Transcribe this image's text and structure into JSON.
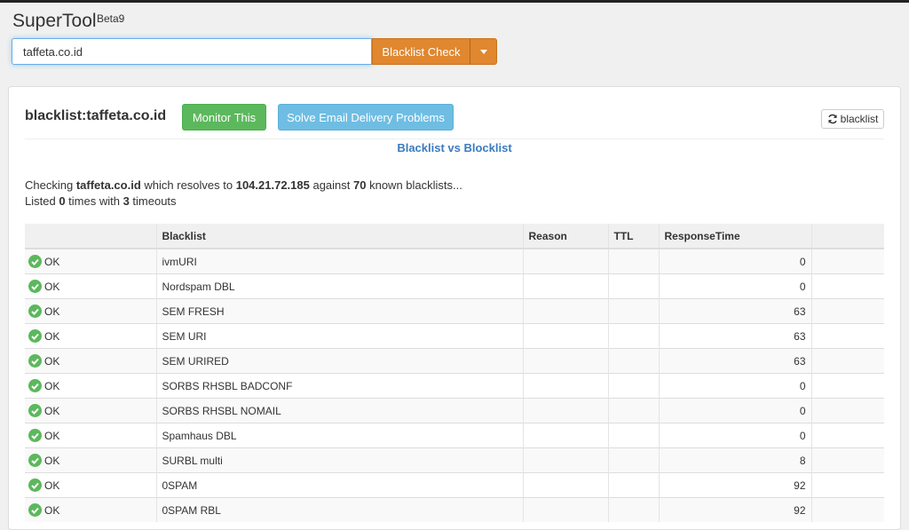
{
  "app": {
    "title": "SuperTool",
    "beta": "Beta9"
  },
  "search": {
    "value": "taffeta.co.id",
    "button_label": "Blacklist Check"
  },
  "panel": {
    "heading": "blacklist:taffeta.co.id",
    "monitor_label": "Monitor This",
    "solve_label": "Solve Email Delivery Problems",
    "refresh_label": "blacklist",
    "link_vs": "Blacklist vs Blocklist"
  },
  "summary": {
    "checking_prefix": "Checking ",
    "domain": "taffeta.co.id",
    "resolves_text": " which resolves to ",
    "ip": "104.21.72.185",
    "against_text": " against ",
    "count": "70",
    "known_text": " known blacklists...",
    "listed_prefix": "Listed ",
    "listed_count": "0",
    "times_text": " times with ",
    "timeouts_count": "3",
    "timeouts_text": " timeouts"
  },
  "table": {
    "columns": [
      "",
      "Blacklist",
      "Reason",
      "TTL",
      "ResponseTime",
      ""
    ],
    "rows": [
      {
        "status": "OK",
        "blacklist": "ivmURI",
        "reason": "",
        "ttl": "",
        "response": "0"
      },
      {
        "status": "OK",
        "blacklist": "Nordspam DBL",
        "reason": "",
        "ttl": "",
        "response": "0"
      },
      {
        "status": "OK",
        "blacklist": "SEM FRESH",
        "reason": "",
        "ttl": "",
        "response": "63"
      },
      {
        "status": "OK",
        "blacklist": "SEM URI",
        "reason": "",
        "ttl": "",
        "response": "63"
      },
      {
        "status": "OK",
        "blacklist": "SEM URIRED",
        "reason": "",
        "ttl": "",
        "response": "63"
      },
      {
        "status": "OK",
        "blacklist": "SORBS RHSBL BADCONF",
        "reason": "",
        "ttl": "",
        "response": "0"
      },
      {
        "status": "OK",
        "blacklist": "SORBS RHSBL NOMAIL",
        "reason": "",
        "ttl": "",
        "response": "0"
      },
      {
        "status": "OK",
        "blacklist": "Spamhaus DBL",
        "reason": "",
        "ttl": "",
        "response": "0"
      },
      {
        "status": "OK",
        "blacklist": "SURBL multi",
        "reason": "",
        "ttl": "",
        "response": "8"
      },
      {
        "status": "OK",
        "blacklist": "0SPAM",
        "reason": "",
        "ttl": "",
        "response": "92"
      },
      {
        "status": "OK",
        "blacklist": "0SPAM RBL",
        "reason": "",
        "ttl": "",
        "response": "92"
      }
    ]
  },
  "colors": {
    "ok": "#5cb85c",
    "check_button": "#e0872f",
    "monitor_button": "#5cb85c",
    "solve_button": "#6fbde3",
    "link": "#3a7bbf"
  },
  "icons": {
    "status_ok": "check-circle-icon",
    "refresh": "refresh-icon",
    "dropdown": "caret-down-icon"
  }
}
